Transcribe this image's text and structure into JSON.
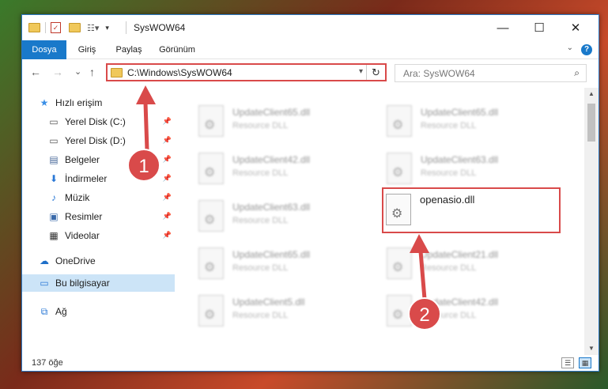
{
  "window": {
    "title": "SysWOW64"
  },
  "title_controls": {
    "minimize": "—",
    "maximize": "☐",
    "close": "✕"
  },
  "ribbon": {
    "tabs": [
      {
        "label": "Dosya",
        "active": true
      },
      {
        "label": "Giriş"
      },
      {
        "label": "Paylaş"
      },
      {
        "label": "Görünüm"
      }
    ],
    "expand_icon": "chevron-down-icon",
    "help": "?"
  },
  "navigation": {
    "back": "←",
    "forward": "→",
    "recent": "⌄",
    "up": "↑",
    "address": "C:\\Windows\\SysWOW64",
    "refresh": "↻",
    "search_placeholder": "Ara: SysWOW64",
    "search_icon": "⌕"
  },
  "sidebar": {
    "items": [
      {
        "label": "Hızlı erişim",
        "icon": "star-icon",
        "glyph": "★"
      },
      {
        "label": "Yerel Disk (C:)",
        "icon": "drive-icon",
        "glyph": "▭",
        "pinned": true
      },
      {
        "label": "Yerel Disk (D:)",
        "icon": "drive-icon",
        "glyph": "▭",
        "pinned": true
      },
      {
        "label": "Belgeler",
        "icon": "documents-icon",
        "glyph": "▤",
        "pinned": true
      },
      {
        "label": "İndirmeler",
        "icon": "download-icon",
        "glyph": "⬇",
        "pinned": true
      },
      {
        "label": "Müzik",
        "icon": "music-icon",
        "glyph": "♪",
        "pinned": true
      },
      {
        "label": "Resimler",
        "icon": "pictures-icon",
        "glyph": "▣",
        "pinned": true
      },
      {
        "label": "Videolar",
        "icon": "video-icon",
        "glyph": "▦",
        "pinned": true
      },
      {
        "label": "OneDrive",
        "icon": "cloud-icon",
        "glyph": "☁"
      },
      {
        "label": "Bu bilgisayar",
        "icon": "computer-icon",
        "glyph": "▭",
        "selected": true
      },
      {
        "label": "Ağ",
        "icon": "network-icon",
        "glyph": "⧉"
      }
    ],
    "pin_glyph": "📌"
  },
  "files": [
    {
      "name": "UpdateClient65.dll",
      "desc": "Resource DLL"
    },
    {
      "name": "UpdateClient65.dll",
      "desc": "Resource DLL"
    },
    {
      "name": "UpdateClient42.dll",
      "desc": "Resource DLL"
    },
    {
      "name": "UpdateClient63.dll",
      "desc": "Resource DLL"
    },
    {
      "name": "UpdateClient63.dll",
      "desc": "Resource DLL"
    },
    {
      "name": "UpdateClient65.dll",
      "desc": "Resource DLL"
    },
    {
      "name": "UpdateClient21.dll",
      "desc": "Resource DLL"
    },
    {
      "name": "UpdateClient5.dll",
      "desc": "Resource DLL"
    },
    {
      "name": "UpdateClient42.dll",
      "desc": "Resource DLL"
    }
  ],
  "target_file": {
    "name": "openasio.dll",
    "icon": "dll-file-icon"
  },
  "annotations": {
    "step1": "1",
    "step2": "2",
    "color": "#d94a4a"
  },
  "status": {
    "count": "137 öğe"
  },
  "view_buttons": {
    "details": "☰",
    "large_icons": "▦"
  }
}
